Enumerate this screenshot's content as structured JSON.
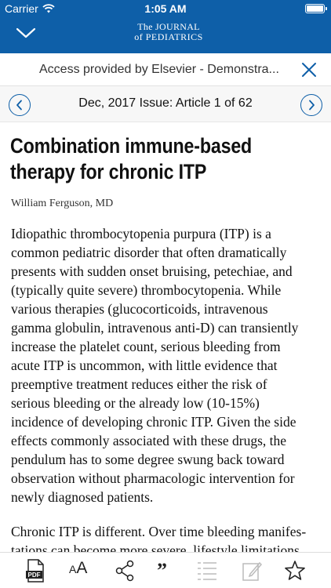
{
  "status_bar": {
    "carrier": "Carrier",
    "time": "1:05 AM"
  },
  "header": {
    "logo_line1": "The JOURNAL",
    "logo_line2": "of PEDIATRICS"
  },
  "banner": {
    "text": "Access provided by Elsevier - Demonstra..."
  },
  "issue_nav": {
    "label": "Dec, 2017 Issue: Article 1 of 62"
  },
  "article": {
    "title_lines": [
      "Combination immune-based",
      "therapy for chronic ITP"
    ],
    "author": "William Ferguson, MD",
    "paragraph1_lines": [
      "Idiopathic thrombocytopenia purpura (ITP) is a",
      "common pediatric disorder that often dramatically",
      "presents with sudden onset bruising, petechiae, and",
      "(typically quite severe) thrombocytopenia. While",
      "various therapies (glucocorticoids, intravenous",
      "gamma globulin, intravenous anti-D) can transiently",
      "increase the platelet count, serious bleeding from",
      "acute ITP is uncommon, with little evidence that",
      "preemptive treatment reduces either the risk of",
      "serious bleeding or the already low (10-15%)",
      "incidence of developing chronic ITP. Given the side",
      "effects commonly associated with these drugs, the",
      "pendulum has to some degree swung back toward",
      "observation without pharmacologic intervention for",
      "newly diagnosed patients."
    ],
    "paragraph2_lines": [
      "Chronic ITP is different. Over time bleeding manifes-",
      "tations can become more severe, lifestyle limitations"
    ]
  },
  "toolbar": {
    "pdf_label": "PDF",
    "aa_small": "A",
    "aa_big": "A",
    "quote_glyph": "”"
  },
  "colors": {
    "brand_blue": "#0e5fa8"
  }
}
